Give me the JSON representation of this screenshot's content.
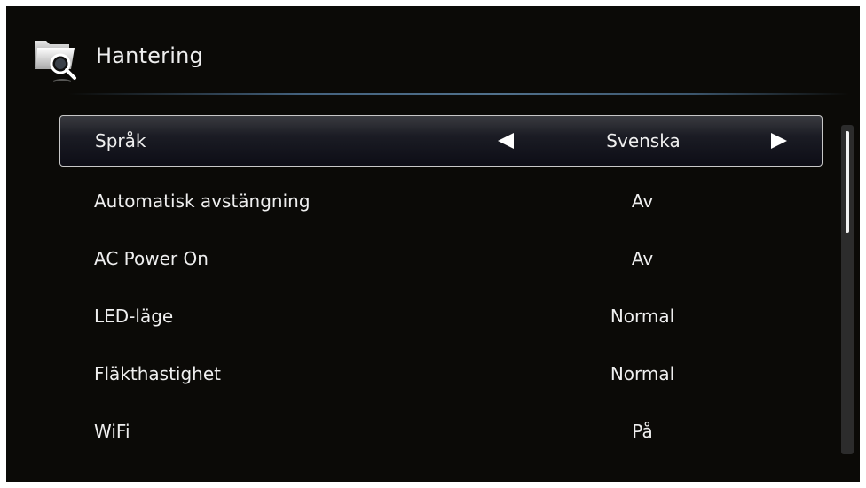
{
  "header": {
    "title": "Hantering",
    "icon": "folder-search-icon"
  },
  "menu": {
    "items": [
      {
        "label": "Språk",
        "value": "Svenska",
        "selected": true
      },
      {
        "label": "Automatisk avstängning",
        "value": "Av",
        "selected": false
      },
      {
        "label": "AC Power On",
        "value": "Av",
        "selected": false
      },
      {
        "label": "LED-läge",
        "value": "Normal",
        "selected": false
      },
      {
        "label": "Fläkthastighet",
        "value": "Normal",
        "selected": false
      },
      {
        "label": "WiFi",
        "value": "På",
        "selected": false
      }
    ]
  },
  "scrollbar": {
    "visible_fraction": 0.32
  },
  "colors": {
    "background": "#0b0a07",
    "text": "#efefef",
    "accent_line": "#51718c",
    "selection_border": "#c8c8c8"
  }
}
